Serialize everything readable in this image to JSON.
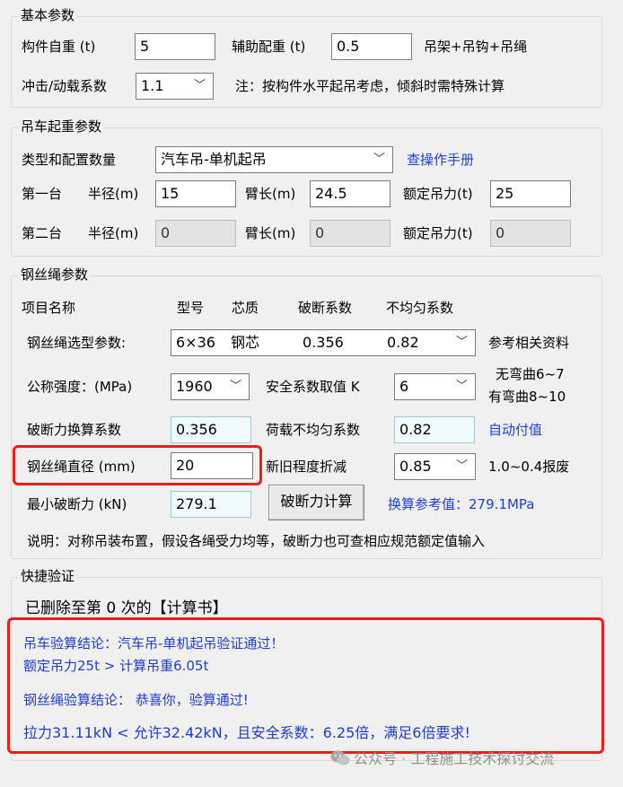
{
  "basic": {
    "title": "基本参数",
    "weight_label": "构件自重 (t)",
    "weight_value": "5",
    "aux_label": "辅助配重 (t)",
    "aux_value": "0.5",
    "aux_note": "吊架+吊钩+吊绳",
    "impact_label": "冲击/动载系数",
    "impact_value": "1.1",
    "impact_note": "注：按构件水平起吊考虑，倾斜时需特殊计算"
  },
  "crane": {
    "title": "吊车起重参数",
    "type_label": "类型和配置数量",
    "type_value": "汽车吊-单机起吊",
    "manual_link": "查操作手册",
    "row1": {
      "label": "第一台",
      "radius_label": "半径(m)",
      "radius": "15",
      "boom_label": "臂长(m)",
      "boom": "24.5",
      "rated_label": "额定吊力(t)",
      "rated": "25"
    },
    "row2": {
      "label": "第二台",
      "radius_label": "半径(m)",
      "radius": "0",
      "boom_label": "臂长(m)",
      "boom": "0",
      "rated_label": "额定吊力(t)",
      "rated": "0"
    }
  },
  "rope": {
    "title": "钢丝绳参数",
    "headers": [
      "项目名称",
      "型号",
      "芯质",
      "破断系数",
      "不均匀系数"
    ],
    "select_label": "钢丝绳选型参数:",
    "select_values": [
      "6×36",
      "钢芯",
      "0.356",
      "0.82"
    ],
    "select_note": "参考相关资料",
    "strength_label": "公称强度：(MPa)",
    "strength_value": "1960",
    "safety_label": "安全系数取值 K",
    "safety_value": "6",
    "safety_note1": "无弯曲6~7",
    "safety_note2": "有弯曲8~10",
    "break_conv_label": "破断力换算系数",
    "break_conv_value": "0.356",
    "uneven_label": "荷载不均匀系数",
    "uneven_value": "0.82",
    "auto_link": "自动付值",
    "diameter_label": "钢丝绳直径 (mm)",
    "diameter_value": "20",
    "wear_label": "新旧程度折减",
    "wear_value": "0.85",
    "wear_note": "1.0~0.4报废",
    "min_break_label": "最小破断力 (kN)",
    "min_break_value": "279.1",
    "calc_button": "破断力计算",
    "ref_value": "换算参考值：279.1MPa",
    "description": "说明：对称吊装布置，假设各绳受力均等，破断力也可查相应规范额定值输入"
  },
  "quick": {
    "title": "快捷验证",
    "deleted_text": "已删除至第 0 次的【计算书】",
    "result_line1": "吊车验算结论：汽车吊-单机起吊验证通过！",
    "result_line2": "额定吊力25t > 计算吊重6.05t",
    "result_line3": "钢丝绳验算结论：  恭喜你，验算通过!",
    "result_line4": "拉力31.11kN < 允许32.42kN，且安全系数：6.25倍，满足6倍要求!"
  },
  "watermark": "公众号 · 工程施工技术探讨交流",
  "colors": {
    "highlight": "#e8201a",
    "link": "#1a3ee0",
    "result_text": "#1f3adb"
  },
  "icons": {
    "dropdown": "chevron-down-icon",
    "wechat": "wechat-icon"
  }
}
